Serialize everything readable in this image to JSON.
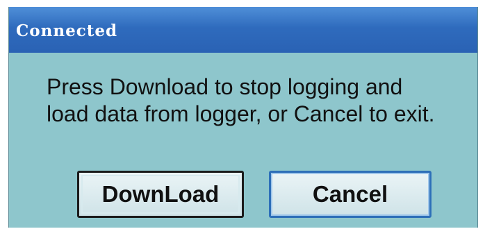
{
  "window": {
    "title": "Connected"
  },
  "dialog": {
    "message": "Press Download to stop logging and load data from logger, or Cancel to exit."
  },
  "buttons": {
    "download_label": "DownLoad",
    "cancel_label": "Cancel"
  },
  "colors": {
    "titlebar": "#2f6bbd",
    "dialog_background": "#8ec6cc",
    "title_text": "#ffffff",
    "body_text": "#111111"
  }
}
